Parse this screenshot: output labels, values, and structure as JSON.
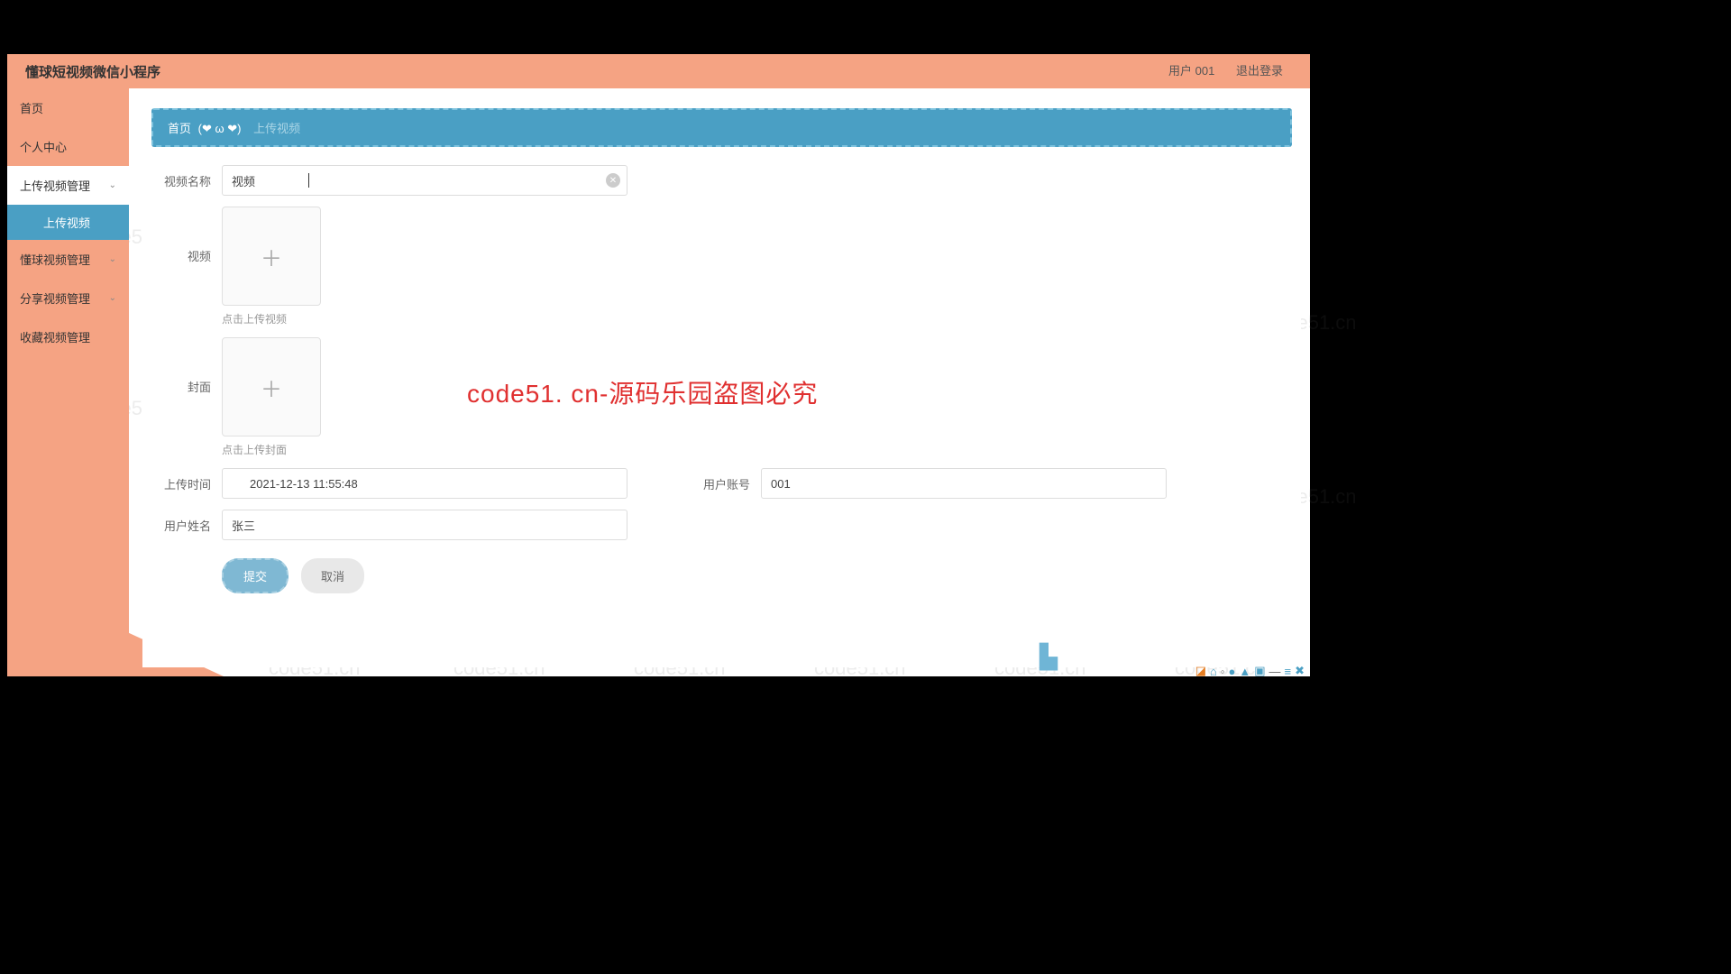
{
  "header": {
    "title": "懂球短视频微信小程序",
    "user_label": "用户 001",
    "logout": "退出登录"
  },
  "sidebar": {
    "items": [
      {
        "label": "首页"
      },
      {
        "label": "个人中心"
      },
      {
        "label": "上传视频管理",
        "expandable": true
      },
      {
        "label": "懂球视频管理",
        "expandable": true
      },
      {
        "label": "分享视频管理",
        "expandable": true
      },
      {
        "label": "收藏视频管理"
      }
    ],
    "subitem": "上传视频"
  },
  "breadcrumb": {
    "home": "首页",
    "emoji": "(❤ ω ❤)",
    "current": "上传视频"
  },
  "form": {
    "video_name_label": "视频名称",
    "video_name_value": "视频",
    "video_label": "视频",
    "video_hint": "点击上传视频",
    "cover_label": "封面",
    "cover_hint": "点击上传封面",
    "upload_time_label": "上传时间",
    "upload_time_value": "2021-12-13 11:55:48",
    "user_account_label": "用户账号",
    "user_account_value": "001",
    "user_name_label": "用户姓名",
    "user_name_value": "张三",
    "submit": "提交",
    "cancel": "取消"
  },
  "watermark_text": "code51.cn",
  "watermark_red": "code51. cn-源码乐园盗图必究"
}
